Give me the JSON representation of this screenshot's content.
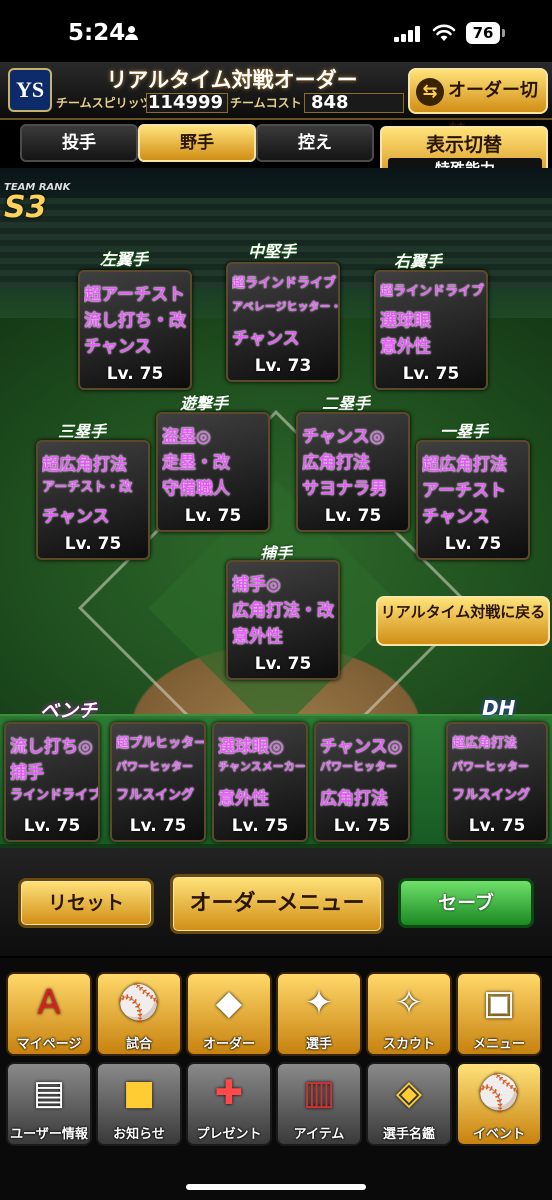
{
  "status_bar": {
    "time": "5:24",
    "battery": "76"
  },
  "header": {
    "logo_text": "YS",
    "title": "リアルタイム対戦オーダー",
    "spirits_label": "チームスピリッツ",
    "spirits_value": "114999",
    "cost_label": "チームコスト",
    "cost_value": "848",
    "order_switch_label": "オーダー切替"
  },
  "tabs": [
    "投手",
    "野手",
    "控え"
  ],
  "active_tab": "野手",
  "display_toggle": {
    "label": "表示切替",
    "mode": "特殊能力"
  },
  "team_rank": {
    "label": "TEAM RANK",
    "value": "S3"
  },
  "positions": {
    "left": {
      "label": "左翼手",
      "abilities": [
        "超アーチスト",
        "流し打ち・改",
        "チャンス"
      ],
      "level": "Lv. 75"
    },
    "center": {
      "label": "中堅手",
      "abilities": [
        "超ラインドライブ",
        "アベレージヒッター・改",
        "チャンス"
      ],
      "level": "Lv. 73"
    },
    "right": {
      "label": "右翼手",
      "abilities": [
        "超ラインドライブ",
        "選球眼",
        "意外性"
      ],
      "level": "Lv. 75"
    },
    "short": {
      "label": "遊撃手",
      "abilities": [
        "盗塁◎",
        "走塁・改",
        "守備職人"
      ],
      "level": "Lv. 75"
    },
    "second": {
      "label": "二塁手",
      "abilities": [
        "チャンス◎",
        "広角打法",
        "サヨナラ男"
      ],
      "level": "Lv. 75"
    },
    "third": {
      "label": "三塁手",
      "abilities": [
        "超広角打法",
        "アーチスト・改",
        "チャンス"
      ],
      "level": "Lv. 75"
    },
    "first": {
      "label": "一塁手",
      "abilities": [
        "超広角打法",
        "アーチスト",
        "チャンス"
      ],
      "level": "Lv. 75"
    },
    "catcher": {
      "label": "捕手",
      "abilities": [
        "捕手◎",
        "広角打法・改",
        "意外性"
      ],
      "level": "Lv. 75"
    }
  },
  "return_button": "リアルタイム対戦に戻る",
  "bench_label": "ベンチ",
  "dh_label": "DH",
  "bench": [
    {
      "abilities": [
        "流し打ち◎",
        "捕手",
        "ラインドライブ"
      ],
      "level": "Lv. 75"
    },
    {
      "abilities": [
        "超プルヒッター",
        "パワーヒッター",
        "フルスイング"
      ],
      "level": "Lv. 75"
    },
    {
      "abilities": [
        "選球眼◎",
        "チャンスメーカー・改",
        "意外性"
      ],
      "level": "Lv. 75"
    },
    {
      "abilities": [
        "チャンス◎",
        "パワーヒッター",
        "広角打法"
      ],
      "level": "Lv. 75"
    }
  ],
  "dh": {
    "abilities": [
      "超広角打法",
      "パワーヒッター",
      "フルスイング"
    ],
    "level": "Lv. 75"
  },
  "actions": {
    "reset": "リセット",
    "order_menu": "オーダーメニュー",
    "save": "セーブ"
  },
  "nav_top": [
    {
      "label": "マイページ",
      "icon": "A"
    },
    {
      "label": "試合",
      "icon": "⚾"
    },
    {
      "label": "オーダー",
      "icon": "◆"
    },
    {
      "label": "選手",
      "icon": "✦"
    },
    {
      "label": "スカウト",
      "icon": "✧"
    },
    {
      "label": "メニュー",
      "icon": "▣"
    }
  ],
  "nav_bottom": [
    {
      "label": "ユーザー情報",
      "icon": "▤"
    },
    {
      "label": "お知らせ",
      "icon": "■"
    },
    {
      "label": "プレゼント",
      "icon": "✚"
    },
    {
      "label": "アイテム",
      "icon": "▥"
    },
    {
      "label": "選手名鑑",
      "icon": "◈"
    },
    {
      "label": "イベント",
      "icon": "⚾"
    }
  ]
}
